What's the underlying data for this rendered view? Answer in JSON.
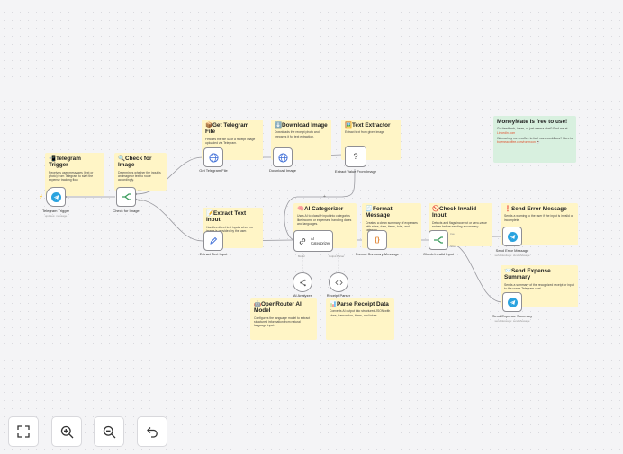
{
  "notes": {
    "telegram_trigger": {
      "title": "📲Telegram Trigger",
      "desc": "Receives user messages (text or photo) from Telegram to start the expense tracking flow."
    },
    "check_image": {
      "title": "🔍Check for Image",
      "desc": "Determines whether the input is an image or text to route accordingly."
    },
    "get_file": {
      "title": "📦Get Telegram File",
      "desc": "Fetches the file ID of a receipt image uploaded via Telegram."
    },
    "download": {
      "title": "⬇️Download Image",
      "desc": "Downloads the receipt photo and prepares it for text extraction."
    },
    "text_extractor": {
      "title": "🖼️Text Extractor",
      "desc": "Extract text from given image"
    },
    "extract_text_input": {
      "title": "📝Extract Text Input",
      "desc": "Handles direct text inputs when no image is provided by the user."
    },
    "ai_categorizer": {
      "title": "🧠AI Categorizer",
      "desc": "Uses AI to classify input into categories like income or expenses, handling dates and languages."
    },
    "format_message": {
      "title": "🧾Format Message",
      "desc": "Creates a clean summary of expenses with store, date, items, total, and category."
    },
    "check_invalid": {
      "title": "🚫Check Invalid Input",
      "desc": "Detects and flags incorrect or zero-value entries before sending a summary."
    },
    "send_error": {
      "title": "❗Send Error Message",
      "desc": "Sends a warning to the user if the input is invalid or incomplete."
    },
    "send_summary": {
      "title": "📨Send Expense Summary",
      "desc": "Sends a summary of the recognized receipt or input to the user's Telegram chat."
    },
    "openrouter": {
      "title": "🤖OpenRouter AI Model",
      "desc": "Configures the language model to extract structured information from natural language input."
    },
    "parse_receipt": {
      "title": "📊Parse Receipt Data",
      "desc": "Converts AI output into structured JSON with store, transaction, items, and totals."
    },
    "moneymate": {
      "title": "MoneyMate is free to use!",
      "desc1": "Got feedback, ideas, or just wanna chat? Find me at",
      "link1": "LinkedIn.com",
      "desc2": "Wanna buy me a coffee to fuel more workflows? Here is",
      "link2": "buymeacoffee.com/ronmoon",
      "desc2_end": "☕"
    }
  },
  "nodes": {
    "telegram_trigger": {
      "label": "Telegram Trigger",
      "sub": "updates: message"
    },
    "check_image": {
      "label": "Check for Image",
      "true_label": "true",
      "false_label": "false"
    },
    "get_file": {
      "label": "Get Telegram File"
    },
    "download": {
      "label": "Download Image"
    },
    "extract_value": {
      "label": "Extract Value From Image",
      "glyph": "?"
    },
    "extract_text_input": {
      "label": "Extract Text Input"
    },
    "ai_categorizer": {
      "label": "AI Categorizer",
      "model_port": "Model",
      "parser_port": "Output Parser"
    },
    "format_summary": {
      "label": "Format Summary Message",
      "glyph": "{}"
    },
    "check_invalid": {
      "label": "Check Invalid Input",
      "true_label": "true",
      "false_label": "false"
    },
    "send_error": {
      "label": "Send Error Message",
      "sub": "sendMessage: sendMessage"
    },
    "send_summary": {
      "label": "Send Expense Summary",
      "sub": "sendMessage: sendMessage"
    },
    "ai_analyzer": {
      "label": "AI Analyzer"
    },
    "receipt_parser": {
      "label": "Receipt Parser"
    }
  },
  "controls": {
    "fit": "fit-view-icon",
    "zoom_in": "zoom-in-icon",
    "zoom_out": "zoom-out-icon",
    "undo": "undo-icon"
  },
  "colors": {
    "sticky": "#fff5c6",
    "sticky_green": "#d8f0df",
    "telegram": "#2aa3df",
    "wire": "#9a9aa0"
  }
}
